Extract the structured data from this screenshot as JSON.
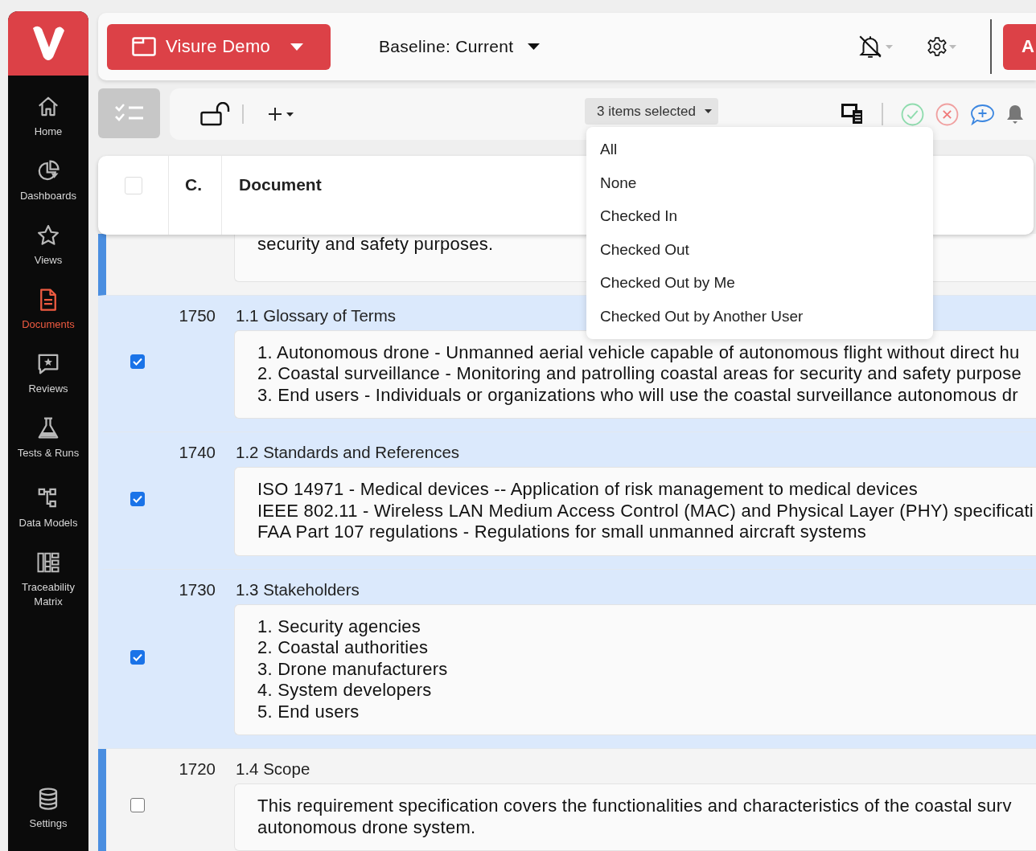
{
  "sidebar": {
    "items": [
      {
        "label": "Home",
        "kind": "home",
        "selected": false
      },
      {
        "label": "Dashboards",
        "kind": "dashboards",
        "selected": false
      },
      {
        "label": "Views",
        "kind": "views",
        "selected": false
      },
      {
        "label": "Documents",
        "kind": "documents",
        "selected": true
      },
      {
        "label": "Reviews",
        "kind": "reviews",
        "selected": false
      },
      {
        "label": "Tests & Runs",
        "kind": "tests",
        "selected": false
      },
      {
        "label": "Data Models",
        "kind": "models",
        "selected": false
      },
      {
        "label": "Traceability Matrix",
        "kind": "matrix",
        "selected": false
      }
    ],
    "bottom_item": {
      "label": "Settings",
      "kind": "database",
      "selected": false
    }
  },
  "top_bar": {
    "project": "Visure Demo",
    "baseline": "Baseline: Current",
    "action_button": "A"
  },
  "toolbar": {
    "selection": "3 items selected"
  },
  "selection_menu": {
    "items": [
      "All",
      "None",
      "Checked In",
      "Checked Out",
      "Checked Out by Me",
      "Checked Out by Another User"
    ]
  },
  "table": {
    "columns": [
      "C.",
      "Document"
    ],
    "header_checked": false,
    "rows": [
      {
        "kind": "partial",
        "selected": false,
        "highlighted": true,
        "lines": [
          "security and safety purposes."
        ]
      },
      {
        "kind": "full",
        "selected": true,
        "highlighted": false,
        "number": "1750",
        "title": "1.1 Glossary of Terms",
        "lines": [
          "1. Autonomous drone - Unmanned aerial vehicle capable of autonomous flight without direct hu",
          "2. Coastal surveillance - Monitoring and patrolling coastal areas for security and safety purpose",
          "3. End users - Individuals or organizations who will use the coastal surveillance autonomous dr"
        ]
      },
      {
        "kind": "full",
        "selected": true,
        "highlighted": false,
        "number": "1740",
        "title": "1.2 Standards and References",
        "lines": [
          "ISO 14971 - Medical devices -- Application of risk management to medical devices",
          "IEEE 802.11 - Wireless LAN Medium Access Control (MAC) and Physical Layer (PHY) specificati",
          "FAA Part 107 regulations - Regulations for small unmanned aircraft systems"
        ]
      },
      {
        "kind": "full",
        "selected": true,
        "highlighted": false,
        "number": "1730",
        "title": "1.3 Stakeholders",
        "lines": [
          "1. Security agencies",
          "2. Coastal authorities",
          "3. Drone manufacturers",
          "4. System developers",
          "5. End users"
        ]
      },
      {
        "kind": "full",
        "selected": false,
        "highlighted": true,
        "number": "1720",
        "title": "1.4 Scope",
        "lines": [
          "This requirement specification covers the functionalities and characteristics of the coastal surv",
          "autonomous drone system."
        ]
      }
    ]
  }
}
